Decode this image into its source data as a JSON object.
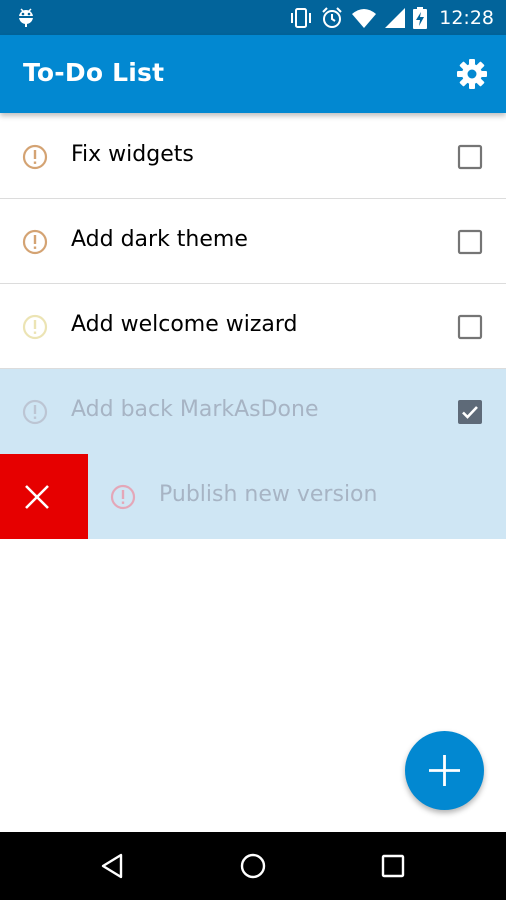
{
  "status_bar": {
    "time": "12:28",
    "icons": [
      "android-debug-icon",
      "vibrate-icon",
      "alarm-icon",
      "wifi-icon",
      "signal-icon",
      "battery-charging-icon"
    ]
  },
  "app_bar": {
    "title": "To-Do List",
    "settings_icon": "gear-icon"
  },
  "tasks": [
    {
      "label": "Fix widgets",
      "priority_color": "#d4a373",
      "checked": false
    },
    {
      "label": "Add dark theme",
      "priority_color": "#d4a373",
      "checked": false
    },
    {
      "label": "Add welcome wizard",
      "priority_color": "#ece4b4",
      "checked": false
    },
    {
      "label": "Add back MarkAsDone",
      "priority_color": "#bcc5d3",
      "checked": true
    }
  ],
  "swiped_task": {
    "label": "Publish new version",
    "priority_color": "#e4a7b8",
    "delete_icon": "close-icon",
    "delete_color": "#e60000"
  },
  "fab": {
    "icon": "plus-icon",
    "color": "#0288d1"
  },
  "colors": {
    "status_bar": "#02649b",
    "app_bar": "#0288d1",
    "done_row": "#cfe6f4"
  }
}
